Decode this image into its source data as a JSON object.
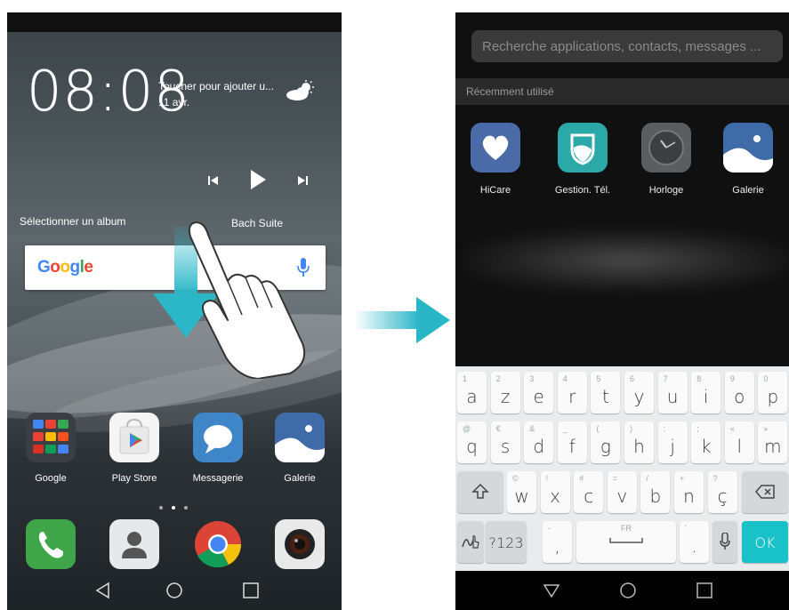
{
  "left_phone": {
    "clock": {
      "time": "08:08",
      "hint": "Toucher pour ajouter u...",
      "date": "11 avr."
    },
    "music": {
      "album_prompt": "Sélectionner un album",
      "track": "Bach Suite"
    },
    "google_search": {
      "logo": "Google",
      "icons": [
        "mic-icon"
      ]
    },
    "gesture": {
      "icons": [
        "swipe-down-arrow",
        "hand-icon"
      ]
    },
    "apps": [
      {
        "label": "Google",
        "icon": "google-folder-icon"
      },
      {
        "label": "Play Store",
        "icon": "play-store-icon"
      },
      {
        "label": "Messagerie",
        "icon": "messages-icon"
      },
      {
        "label": "Galerie",
        "icon": "gallery-icon"
      }
    ],
    "page_indicator": {
      "count": 3,
      "active": 1
    },
    "hotseat": [
      "phone-icon",
      "contacts-icon",
      "chrome-icon",
      "camera-icon"
    ],
    "nav": [
      "back-icon",
      "home-icon",
      "recents-icon"
    ]
  },
  "transition_arrow": {
    "color": "#29b6c6"
  },
  "right_phone": {
    "search": {
      "placeholder": "Recherche applications, contacts, messages ..."
    },
    "recent_header": "Récemment utilisé",
    "recent_apps": [
      {
        "label": "HiCare",
        "icon": "hicare-icon"
      },
      {
        "label": "Gestion. Tél.",
        "icon": "phone-manager-icon"
      },
      {
        "label": "Horloge",
        "icon": "clock-icon"
      },
      {
        "label": "Galerie",
        "icon": "gallery-icon"
      }
    ],
    "keyboard": {
      "row1": [
        {
          "hint": "1",
          "ch": "a"
        },
        {
          "hint": "2",
          "ch": "z"
        },
        {
          "hint": "3",
          "ch": "e"
        },
        {
          "hint": "4",
          "ch": "r"
        },
        {
          "hint": "5",
          "ch": "t"
        },
        {
          "hint": "6",
          "ch": "y"
        },
        {
          "hint": "7",
          "ch": "u"
        },
        {
          "hint": "8",
          "ch": "i"
        },
        {
          "hint": "9",
          "ch": "o"
        },
        {
          "hint": "0",
          "ch": "p"
        }
      ],
      "row2": [
        {
          "hint": "@",
          "ch": "q"
        },
        {
          "hint": "€",
          "ch": "s"
        },
        {
          "hint": "&",
          "ch": "d"
        },
        {
          "hint": "_",
          "ch": "f"
        },
        {
          "hint": "(",
          "ch": "g"
        },
        {
          "hint": ")",
          "ch": "h"
        },
        {
          "hint": ":",
          "ch": "j"
        },
        {
          "hint": ";",
          "ch": "k"
        },
        {
          "hint": "«",
          "ch": "l"
        },
        {
          "hint": "»",
          "ch": "m"
        }
      ],
      "row3": [
        {
          "hint": "©",
          "ch": "w"
        },
        {
          "hint": "!",
          "ch": "x"
        },
        {
          "hint": "#",
          "ch": "c"
        },
        {
          "hint": "=",
          "ch": "v"
        },
        {
          "hint": "/",
          "ch": "b"
        },
        {
          "hint": "+",
          "ch": "n"
        },
        {
          "hint": "?",
          "ch": "ç"
        }
      ],
      "symbols_key": "?123",
      "comma": ",",
      "comma_hint": "-",
      "space_label": "FR",
      "period": ".",
      "period_hint": "'",
      "ok": "OK",
      "accent_color": "#19c1c8"
    },
    "nav": [
      "back-icon",
      "home-icon",
      "recents-icon"
    ]
  }
}
